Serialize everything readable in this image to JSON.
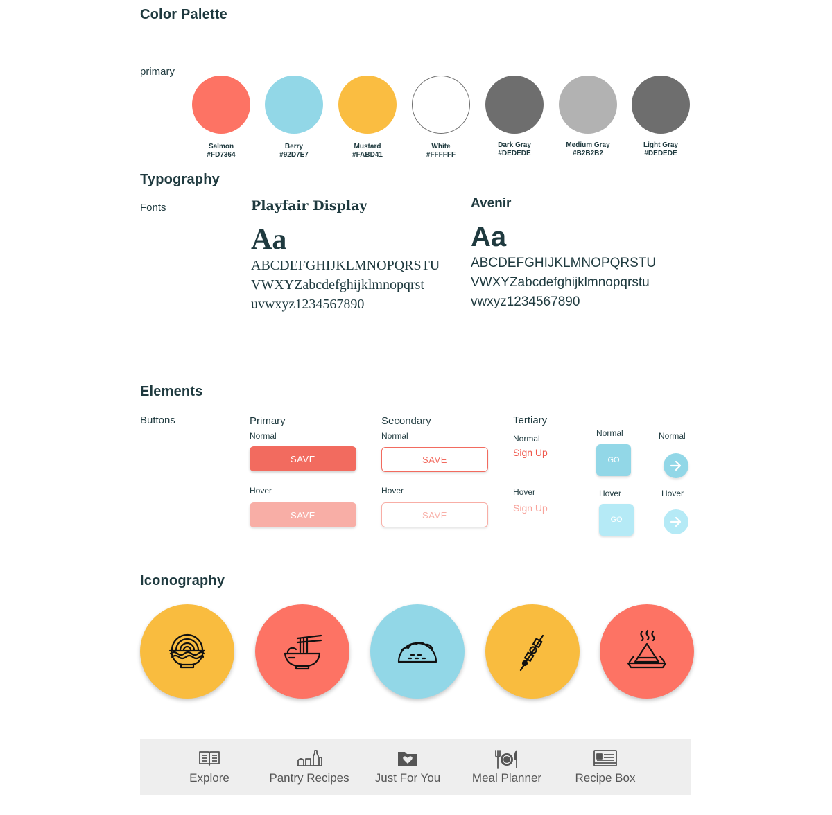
{
  "sections": {
    "color_palette": "Color Palette",
    "typography": "Typography",
    "elements": "Elements",
    "iconography": "Iconography"
  },
  "palette": {
    "label": "primary",
    "swatches": [
      {
        "name": "Salmon",
        "hex": "#FD7364",
        "color": "#FD7364"
      },
      {
        "name": "Berry",
        "hex": "#92D7E7",
        "color": "#92D7E7"
      },
      {
        "name": "Mustard",
        "hex": "#FABD41",
        "color": "#FABD41"
      },
      {
        "name": "White",
        "hex": "#FFFFFF",
        "color": "#FFFFFF"
      },
      {
        "name": "Dark Gray",
        "hex": "#DEDEDE",
        "color": "#6E6E6E"
      },
      {
        "name": "Medium Gray",
        "hex": "#B2B2B2",
        "color": "#B2B2B2"
      },
      {
        "name": "Light Gray",
        "hex": "#DEDEDE",
        "color": "#6E6E6E"
      }
    ]
  },
  "typography": {
    "label": "Fonts",
    "fonts": [
      {
        "name": "Playfair Display",
        "aa": "Aa",
        "lines": [
          "ABCDEFGHIJKLMNOPQRSTU",
          "VWXYZabcdefghijklmnopqrst",
          "uvwxyz1234567890"
        ]
      },
      {
        "name": "Avenir",
        "aa": "Aa",
        "lines": [
          "ABCDEFGHIJKLMNOPQRSTU",
          "VWXYZabcdefghijklmnopqrstu",
          "vwxyz1234567890"
        ]
      }
    ]
  },
  "elements": {
    "label": "Buttons",
    "primary": {
      "title": "Primary",
      "normal": "Normal",
      "hover": "Hover",
      "button_label": "SAVE"
    },
    "secondary": {
      "title": "Secondary",
      "normal": "Normal",
      "hover": "Hover",
      "button_label": "SAVE"
    },
    "tertiary": {
      "title": "Tertiary",
      "normal": "Normal",
      "hover": "Hover",
      "link_label": "Sign Up"
    },
    "go": {
      "normal": "Normal",
      "hover": "Hover",
      "label": "GO"
    },
    "arrow": {
      "normal": "Normal",
      "hover": "Hover"
    }
  },
  "iconography": {
    "icons": [
      {
        "icon": "ramen-bowl-icon",
        "color": "#F9BC3F"
      },
      {
        "icon": "noodle-bowl-chopsticks-icon",
        "color": "#FD7364"
      },
      {
        "icon": "taco-icon",
        "color": "#92D7E7"
      },
      {
        "icon": "kebab-skewer-icon",
        "color": "#F9BC3F"
      },
      {
        "icon": "samosa-plate-icon",
        "color": "#FD7364"
      }
    ]
  },
  "tabbar": {
    "tabs": [
      {
        "label": "Explore",
        "icon": "book-icon"
      },
      {
        "label": "Pantry Recipes",
        "icon": "pantry-icon"
      },
      {
        "label": "Just For You",
        "icon": "heart-folder-icon"
      },
      {
        "label": "Meal Planner",
        "icon": "plate-fork-knife-icon"
      },
      {
        "label": "Recipe Box",
        "icon": "recipe-card-icon"
      }
    ]
  },
  "colors": {
    "text": "#1F3A3F",
    "accent": "#F26B5F",
    "accent_light": "#F8AEA6",
    "go": "#92D7E7",
    "go_hover": "#B5EAF6",
    "tabbar_bg": "#EEEEEE"
  }
}
